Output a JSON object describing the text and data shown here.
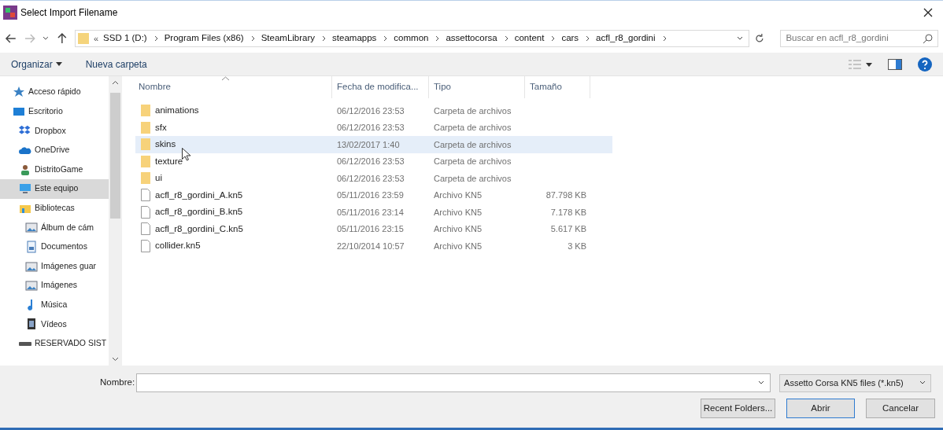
{
  "window": {
    "title": "Select Import Filename"
  },
  "address": {
    "overflow": "«",
    "crumbs": [
      "SSD 1 (D:)",
      "Program Files (x86)",
      "SteamLibrary",
      "steamapps",
      "common",
      "assettocorsa",
      "content",
      "cars",
      "acfl_r8_gordini"
    ]
  },
  "search": {
    "placeholder": "Buscar en acfl_r8_gordini"
  },
  "toolbar": {
    "organize": "Organizar",
    "new_folder": "Nueva carpeta"
  },
  "sidebar": {
    "items": [
      {
        "label": "Acceso rápido",
        "kind": "star",
        "selected": false
      },
      {
        "label": "Escritorio",
        "kind": "desktop",
        "selected": false,
        "children": [
          {
            "label": "Dropbox",
            "kind": "dropbox",
            "selected": false
          },
          {
            "label": "OneDrive",
            "kind": "cloud",
            "selected": false
          },
          {
            "label": "DistritoGame",
            "kind": "user",
            "selected": false
          },
          {
            "label": "Este equipo",
            "kind": "computer",
            "selected": true
          },
          {
            "label": "Bibliotecas",
            "kind": "library",
            "selected": false,
            "children": [
              {
                "label": "Álbum de cám",
                "kind": "picture",
                "selected": false
              },
              {
                "label": "Documentos",
                "kind": "document",
                "selected": false
              },
              {
                "label": "Imágenes guar",
                "kind": "picture",
                "selected": false
              },
              {
                "label": "Imágenes",
                "kind": "picture",
                "selected": false
              },
              {
                "label": "Música",
                "kind": "music",
                "selected": false
              },
              {
                "label": "Vídeos",
                "kind": "video",
                "selected": false
              }
            ]
          },
          {
            "label": "RESERVADO SIST",
            "kind": "drive",
            "selected": false
          }
        ]
      }
    ]
  },
  "table": {
    "columns": [
      "Nombre",
      "Fecha de modifica...",
      "Tipo",
      "Tamaño"
    ],
    "rows": [
      {
        "kind": "folder",
        "name": "animations",
        "date": "06/12/2016 23:53",
        "type": "Carpeta de archivos",
        "selected": false
      },
      {
        "kind": "folder",
        "name": "sfx",
        "date": "06/12/2016 23:53",
        "type": "Carpeta de archivos",
        "selected": false
      },
      {
        "kind": "folder",
        "name": "skins",
        "date": "13/02/2017 1:40",
        "type": "Carpeta de archivos",
        "selected": true
      },
      {
        "kind": "folder",
        "name": "texture",
        "date": "06/12/2016 23:53",
        "type": "Carpeta de archivos",
        "selected": false
      },
      {
        "kind": "folder",
        "name": "ui",
        "date": "06/12/2016 23:53",
        "type": "Carpeta de archivos",
        "selected": false
      },
      {
        "kind": "file",
        "name": "acfl_r8_gordini_A.kn5",
        "date": "05/11/2016 23:59",
        "type": "Archivo KN5",
        "size": "87.798 KB",
        "selected": false
      },
      {
        "kind": "file",
        "name": "acfl_r8_gordini_B.kn5",
        "date": "05/11/2016 23:14",
        "type": "Archivo KN5",
        "size": "7.178 KB",
        "selected": false
      },
      {
        "kind": "file",
        "name": "acfl_r8_gordini_C.kn5",
        "date": "05/11/2016 23:15",
        "type": "Archivo KN5",
        "size": "5.617 KB",
        "selected": false
      },
      {
        "kind": "file",
        "name": "collider.kn5",
        "date": "22/10/2014 10:57",
        "type": "Archivo KN5",
        "size": "3 KB",
        "selected": false
      }
    ]
  },
  "footer": {
    "filename_label": "Nombre:",
    "filter": "Assetto Corsa KN5 files (*.kn5)",
    "buttons": [
      "Recent Folders...",
      "Abrir",
      "Cancelar"
    ]
  }
}
